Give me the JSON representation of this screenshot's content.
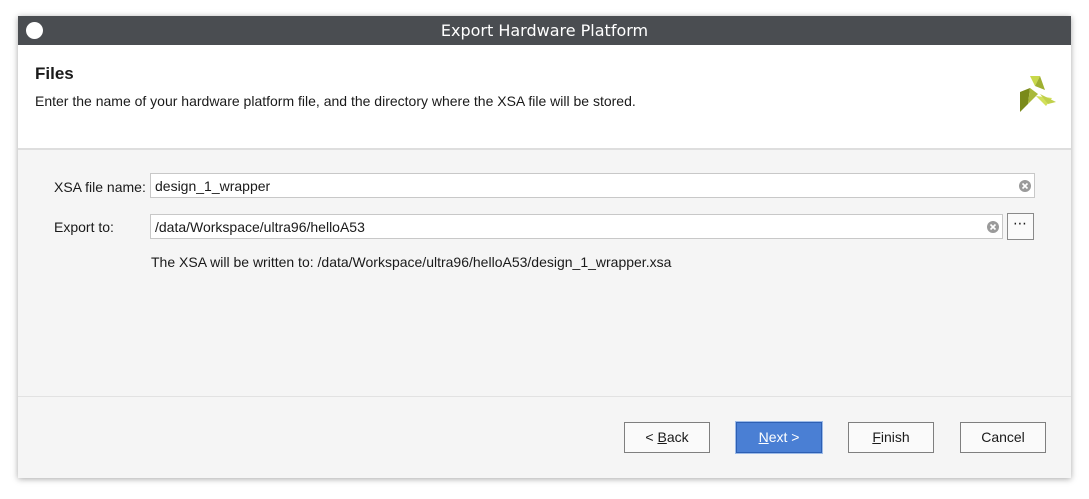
{
  "window": {
    "title": "Export Hardware Platform"
  },
  "header": {
    "title": "Files",
    "description": "Enter the name of your hardware platform file, and the directory where the XSA file will be stored."
  },
  "form": {
    "xsa_label": "XSA file name:",
    "xsa_value": "design_1_wrapper",
    "export_label": "Export to:",
    "export_value": "/data/Workspace/ultra96/helloA53",
    "browse_label": "⋯",
    "note": "The XSA will be written to: /data/Workspace/ultra96/helloA53/design_1_wrapper.xsa"
  },
  "buttons": {
    "back_prefix": "< ",
    "back_mnemonic": "B",
    "back_rest": "ack",
    "next_mnemonic": "N",
    "next_rest": "ext >",
    "finish_mnemonic": "F",
    "finish_rest": "inish",
    "cancel": "Cancel"
  },
  "icons": {
    "close": "window-close-icon",
    "logo": "xilinx-logo-icon",
    "clear": "clear-field-icon"
  },
  "colors": {
    "titlebar": "#4a4d51",
    "primary_button": "#4a7fd4",
    "logo_dark": "#7a8a1a",
    "logo_light": "#c8d84a"
  }
}
